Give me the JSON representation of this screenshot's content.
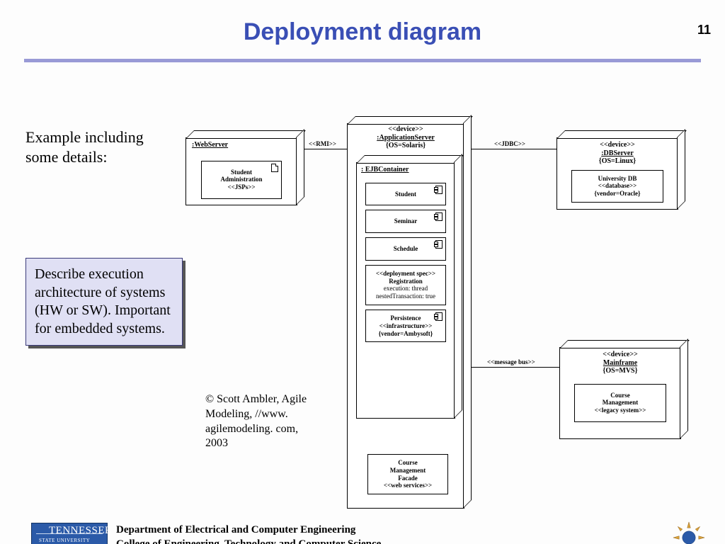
{
  "page_number": "11",
  "title": "Deployment diagram",
  "intro": "Example including some details:",
  "description": "Describe execution architecture of systems (HW or SW). Important for embedded systems.",
  "credit": "© Scott Ambler, Agile Modeling, //www. agilemodeling. com, 2003",
  "footer": {
    "line1": "Department of Electrical and Computer Engineering",
    "line2": "College of Engineering, Technology and Computer Science",
    "logo_main": "TENNESSEE",
    "logo_sub": "STATE UNIVERSITY"
  },
  "diagram": {
    "webserver": {
      "title_ul": ":WebServer",
      "comp": {
        "line1": "Student",
        "line2": "Administration",
        "line3": "<<JSPs>>"
      }
    },
    "appserver": {
      "stereo": "<<device>>",
      "title_ul": ":ApplicationServer",
      "tag": "{OS=Solaris}",
      "ejb_title": ": EJBContainer",
      "components": {
        "student": "Student",
        "seminar": "Seminar",
        "schedule": "Schedule",
        "deploy": {
          "l1": "<<deployment spec>>",
          "l2": "Registration",
          "l3": "execution: thread",
          "l4": "nestedTransaction: true"
        },
        "persist": {
          "l1": "Persistence",
          "l2": "<<infrastructure>>",
          "l3": "{vendor=Ambysoft}"
        },
        "facade": {
          "l1": "Course",
          "l2": "Management",
          "l3": "Facade",
          "l4": "<<web services>>"
        }
      }
    },
    "dbserver": {
      "stereo": "<<device>>",
      "title_ul": ":DBServer",
      "tag": "{OS=Linux}",
      "comp": {
        "l1": "University DB",
        "l2": "<<database>>",
        "l3": "{vendor=Oracle}"
      }
    },
    "mainframe": {
      "stereo": "<<device>>",
      "title_ul": "Mainframe",
      "tag": "{OS=MVS}",
      "comp": {
        "l1": "Course",
        "l2": "Management",
        "l3": "<<legacy system>>"
      }
    },
    "connectors": {
      "rmi": "<<RMI>>",
      "jdbc": "<<JDBC>>",
      "mbus": "<<message bus>>"
    }
  }
}
